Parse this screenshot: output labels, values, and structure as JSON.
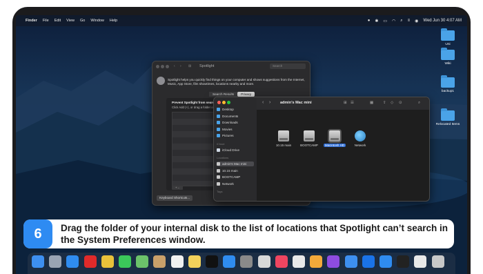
{
  "menubar": {
    "apple": "",
    "items": [
      "Finder",
      "File",
      "Edit",
      "View",
      "Go",
      "Window",
      "Help"
    ],
    "clock": "Wed Jun 30  4:07 AM"
  },
  "desktop": {
    "icons": [
      {
        "label": "Uni"
      },
      {
        "label": "Wiki"
      },
      {
        "label": "backup1"
      },
      {
        "label": "Relocated Items"
      }
    ]
  },
  "prefs": {
    "title": "Spotlight",
    "search_placeholder": "Search",
    "description": "Spotlight helps you quickly find things on your computer and shows suggestions from the Internet, Music, App Store, film showtimes, locations nearby and more.",
    "tabs": [
      {
        "label": "Search Results"
      },
      {
        "label": "Privacy"
      }
    ],
    "panel_title": "Prevent Spotlight from search",
    "panel_hint": "Click Add (+), or drag a folder o",
    "plus_minus": "+  –",
    "keyboard_button": "Keyboard Shortcuts..."
  },
  "finder": {
    "title": "admin's Mac mini",
    "sidebar": {
      "favourites": [
        {
          "label": "Desktop",
          "color": "#4aa3e8"
        },
        {
          "label": "Documents",
          "color": "#4aa3e8"
        },
        {
          "label": "Downloads",
          "color": "#4aa3e8"
        },
        {
          "label": "Movies",
          "color": "#4aa3e8"
        },
        {
          "label": "Pictures",
          "color": "#4aa3e8"
        }
      ],
      "icloud_header": "iCloud",
      "icloud": [
        {
          "label": "iCloud Drive",
          "color": "#cfd8e3"
        }
      ],
      "locations_header": "Locations",
      "locations": [
        {
          "label": "admin's Mac mini",
          "color": "#c8c8c8"
        },
        {
          "label": "10.15 main",
          "color": "#c8c8c8"
        },
        {
          "label": "BOOTCAMP",
          "color": "#c8c8c8"
        },
        {
          "label": "Network",
          "color": "#c8c8c8"
        }
      ],
      "tags_header": "Tags"
    },
    "items": [
      {
        "label": "10.15 main",
        "kind": "disk"
      },
      {
        "label": "BOOTCAMP",
        "kind": "disk"
      },
      {
        "label": "Macintosh HD",
        "kind": "disk",
        "selected": true
      },
      {
        "label": "Network",
        "kind": "network"
      }
    ]
  },
  "caption": {
    "step": "6",
    "text": "Drag the folder of your internal disk to the list of locations that Spotlight can’t search in the System Preferences window."
  },
  "dock": {
    "icons": [
      {
        "name": "finder-icon",
        "color": "#3d8ff0"
      },
      {
        "name": "launchpad-icon",
        "color": "#9aa4b3"
      },
      {
        "name": "safari-icon",
        "color": "#2f8cf0"
      },
      {
        "name": "opera-icon",
        "color": "#e02a2a"
      },
      {
        "name": "chrome-icon",
        "color": "#e8c13a"
      },
      {
        "name": "messages-icon",
        "color": "#3bc85a"
      },
      {
        "name": "maps-icon",
        "color": "#6cc26a"
      },
      {
        "name": "contacts-icon",
        "color": "#c9a06a"
      },
      {
        "name": "reminders-icon",
        "color": "#f0f0f0"
      },
      {
        "name": "notes-icon",
        "color": "#f2d15b"
      },
      {
        "name": "tv-icon",
        "color": "#111111"
      },
      {
        "name": "appstore-icon",
        "color": "#2f8cf0"
      },
      {
        "name": "system-preferences-icon",
        "color": "#8a8a8a"
      },
      {
        "name": "preview-icon",
        "color": "#d8d8d8"
      },
      {
        "name": "music-icon",
        "color": "#f04560"
      },
      {
        "name": "script-editor-icon",
        "color": "#e9e9e9"
      },
      {
        "name": "photos-icon",
        "color": "#f2a93a"
      },
      {
        "name": "feedback-icon",
        "color": "#8e4ce0"
      },
      {
        "name": "mail-icon",
        "color": "#3d8ff0"
      },
      {
        "name": "teamviewer-icon",
        "color": "#1a73e8"
      },
      {
        "name": "mk-icon",
        "color": "#2f8cf0"
      },
      {
        "name": "cleanmymac-icon",
        "color": "#222222"
      },
      {
        "name": "documents-stack-icon",
        "color": "#e8e8e8"
      },
      {
        "name": "trash-icon",
        "color": "#c8c8c8"
      }
    ]
  }
}
